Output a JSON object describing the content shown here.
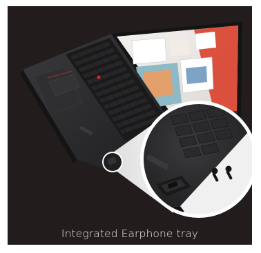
{
  "caption": "Integrated Earphone tray",
  "colors": {
    "background": "#221d1c",
    "laptop_body": "#2a2a2c",
    "screen_accent": "#d9402b",
    "trackpoint": "#d8232a"
  },
  "icons": [
    "laptop-illustration",
    "earphone-tray-icon",
    "earbud-icon"
  ]
}
